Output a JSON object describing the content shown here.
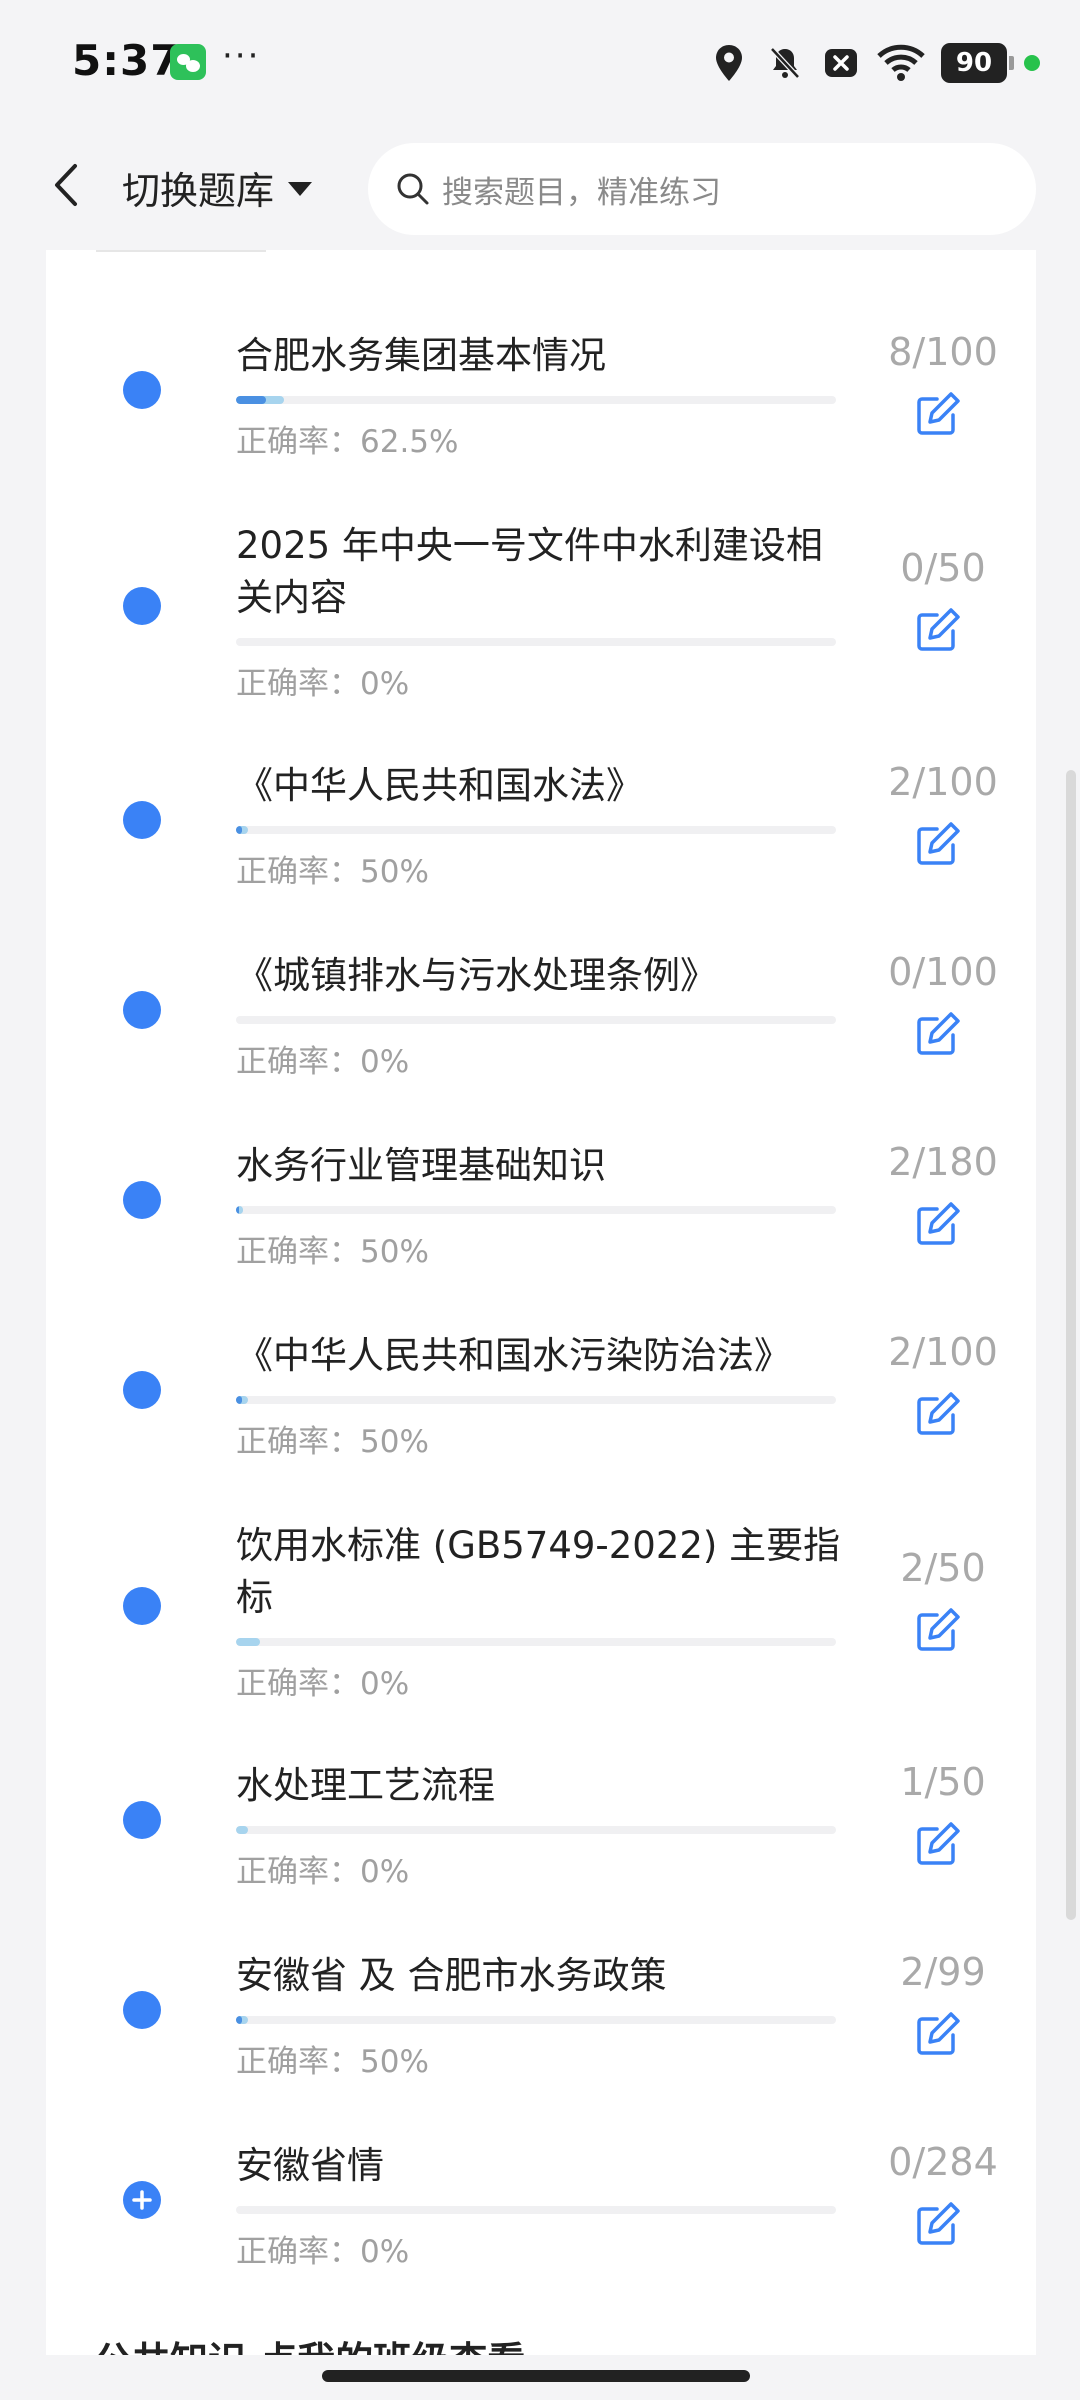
{
  "status_bar": {
    "time": "5:37",
    "more": "···",
    "battery": "90",
    "icons": [
      "wechat-icon",
      "location-icon",
      "mute-bell-icon",
      "close-box-icon",
      "wifi-icon",
      "battery-icon"
    ]
  },
  "header": {
    "switch_bank_label": "切换题库",
    "search_placeholder": "搜索题目，精准练习"
  },
  "chapters": [
    {
      "title": "合肥水务集团基本情况",
      "accuracy": "正确率：62.5%",
      "count": "8/100",
      "answered": 8,
      "total": 100,
      "correct_rate": 0.625
    },
    {
      "title": "2025 年中央一号文件中水利建设相关内容",
      "accuracy": "正确率：0%",
      "count": "0/50",
      "answered": 0,
      "total": 50,
      "correct_rate": 0
    },
    {
      "title": "《中华人民共和国水法》",
      "accuracy": "正确率：50%",
      "count": "2/100",
      "answered": 2,
      "total": 100,
      "correct_rate": 0.5
    },
    {
      "title": "《城镇排水与污水处理条例》",
      "accuracy": "正确率：0%",
      "count": "0/100",
      "answered": 0,
      "total": 100,
      "correct_rate": 0
    },
    {
      "title": "水务行业管理基础知识",
      "accuracy": "正确率：50%",
      "count": "2/180",
      "answered": 2,
      "total": 180,
      "correct_rate": 0.5
    },
    {
      "title": "《中华人民共和国水污染防治法》",
      "accuracy": "正确率：50%",
      "count": "2/100",
      "answered": 2,
      "total": 100,
      "correct_rate": 0.5
    },
    {
      "title": "饮用水标准 (GB5749-2022) 主要指标",
      "accuracy": "正确率：0%",
      "count": "2/50",
      "answered": 2,
      "total": 50,
      "correct_rate": 0
    },
    {
      "title": "水处理工艺流程",
      "accuracy": "正确率：0%",
      "count": "1/50",
      "answered": 1,
      "total": 50,
      "correct_rate": 0
    },
    {
      "title": "安徽省 及 合肥市水务政策",
      "accuracy": "正确率：50%",
      "count": "2/99",
      "answered": 2,
      "total": 99,
      "correct_rate": 0.5
    },
    {
      "title": "安徽省情",
      "accuracy": "正确率：0%",
      "count": "0/284",
      "answered": 0,
      "total": 284,
      "correct_rate": 0,
      "expandable": true
    }
  ],
  "next_section_title": "公共知识 点我的班级查看",
  "colors": {
    "accent": "#3a82f6",
    "progress_answered": "#a7d4ee",
    "progress_correct": "#4a90e2",
    "muted_text": "#a0a0a0"
  }
}
